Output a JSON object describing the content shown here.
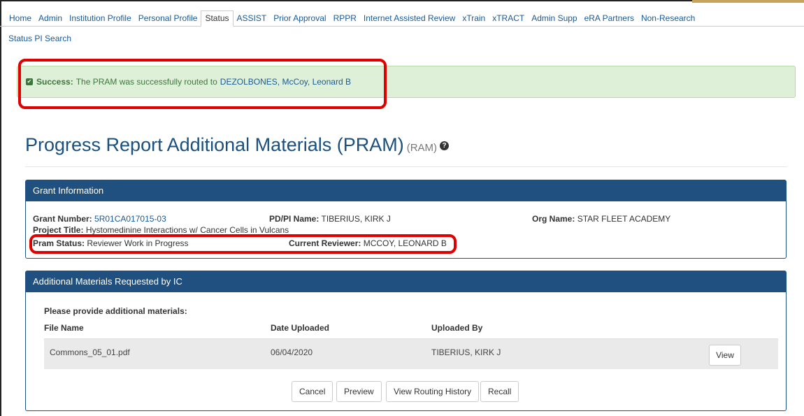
{
  "nav": {
    "tabs": [
      {
        "label": "Home"
      },
      {
        "label": "Admin"
      },
      {
        "label": "Institution Profile"
      },
      {
        "label": "Personal Profile"
      },
      {
        "label": "Status",
        "active": true
      },
      {
        "label": "ASSIST"
      },
      {
        "label": "Prior Approval"
      },
      {
        "label": "RPPR"
      },
      {
        "label": "Internet Assisted Review"
      },
      {
        "label": "xTrain"
      },
      {
        "label": "xTRACT"
      },
      {
        "label": "Admin Supp"
      },
      {
        "label": "eRA Partners"
      },
      {
        "label": "Non-Research"
      }
    ],
    "sub_link": "Status PI Search"
  },
  "alert": {
    "label": "Success:",
    "message": "The PRAM was successfully routed to",
    "reviewer": "DEZOLBONES, McCoy, Leonard B"
  },
  "page": {
    "title": "Progress Report Additional Materials (PRAM)",
    "code": "(RAM)",
    "help_glyph": "?"
  },
  "grant": {
    "header": "Grant Information",
    "grant_number_label": "Grant Number:",
    "grant_number": "5R01CA017015-03",
    "pdpi_label": "PD/PI Name:",
    "pdpi": "TIBERIUS, KIRK J",
    "org_label": "Org Name:",
    "org": "STAR FLEET ACADEMY",
    "project_title_label": "Project Title:",
    "project_title": "Hystomedinine Interactions w/ Cancer Cells in Vulcans",
    "pram_status_label": "Pram Status:",
    "pram_status": "Reviewer Work in Progress",
    "current_reviewer_label": "Current Reviewer:",
    "current_reviewer": "MCCOY, LEONARD B"
  },
  "materials": {
    "header": "Additional Materials Requested by IC",
    "intro": "Please provide additional materials:",
    "columns": [
      "File Name",
      "Date Uploaded",
      "Uploaded By"
    ],
    "rows": [
      {
        "file_name": "Commons_05_01.pdf",
        "date_uploaded": "06/04/2020",
        "uploaded_by": "TIBERIUS, KIRK J",
        "action": "View"
      }
    ]
  },
  "actions": {
    "cancel": "Cancel",
    "preview": "Preview",
    "routing_history": "View Routing History",
    "recall": "Recall"
  },
  "colors": {
    "highlight": "#e00000",
    "panel_header": "#1f5080",
    "success_bg": "#dff0d8",
    "link": "#1a5a96"
  }
}
